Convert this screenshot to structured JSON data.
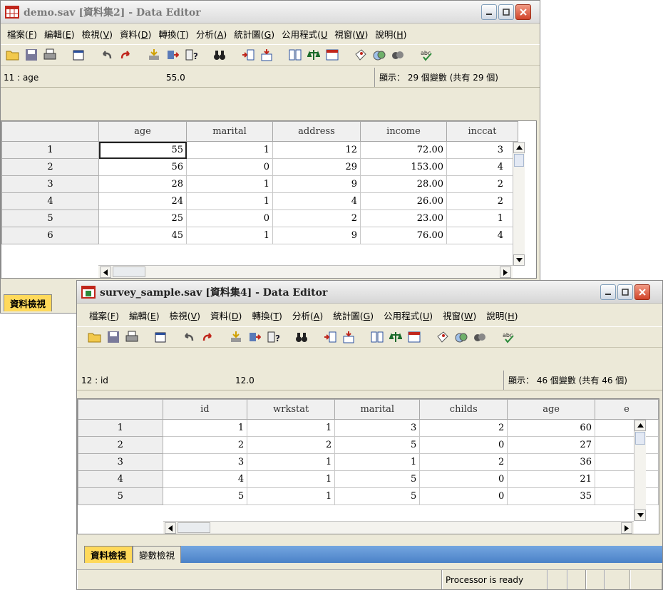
{
  "window1": {
    "title": "demo.sav [資料集2] - Data Editor",
    "menu": [
      {
        "label": "檔案(",
        "key": "F",
        "end": ")"
      },
      {
        "label": "編輯(",
        "key": "E",
        "end": ")"
      },
      {
        "label": "檢視(",
        "key": "V",
        "end": ")"
      },
      {
        "label": "資料(",
        "key": "D",
        "end": ")"
      },
      {
        "label": "轉換(",
        "key": "T",
        "end": ")"
      },
      {
        "label": "分析(",
        "key": "A",
        "end": ")"
      },
      {
        "label": "統計圖(",
        "key": "G",
        "end": ")"
      },
      {
        "label": "公用程式(",
        "key": "U",
        "end": ""
      },
      {
        "label": "視窗(",
        "key": "W",
        "end": ")"
      },
      {
        "label": "說明(",
        "key": "H",
        "end": ")"
      }
    ],
    "cell_ref": "11 : age",
    "cell_value": "55.0",
    "var_info": "顯示： 29 個變數 (共有 29 個)",
    "columns": [
      "age",
      "marital",
      "address",
      "income",
      "inccat"
    ],
    "rows": [
      [
        "1",
        "55",
        "1",
        "12",
        "72.00",
        "3"
      ],
      [
        "2",
        "56",
        "0",
        "29",
        "153.00",
        "4"
      ],
      [
        "3",
        "28",
        "1",
        "9",
        "28.00",
        "2"
      ],
      [
        "4",
        "24",
        "1",
        "4",
        "26.00",
        "2"
      ],
      [
        "5",
        "25",
        "0",
        "2",
        "23.00",
        "1"
      ],
      [
        "6",
        "45",
        "1",
        "9",
        "76.00",
        "4"
      ]
    ],
    "tab_data_view": "資料檢視"
  },
  "window2": {
    "title": "survey_sample.sav [資料集4] - Data Editor",
    "menu": [
      {
        "label": "檔案(",
        "key": "F",
        "end": ")"
      },
      {
        "label": "編輯(",
        "key": "E",
        "end": ")"
      },
      {
        "label": "檢視(",
        "key": "V",
        "end": ")"
      },
      {
        "label": "資料(",
        "key": "D",
        "end": ")"
      },
      {
        "label": "轉換(",
        "key": "T",
        "end": ")"
      },
      {
        "label": "分析(",
        "key": "A",
        "end": ")"
      },
      {
        "label": "統計圖(",
        "key": "G",
        "end": ")"
      },
      {
        "label": "公用程式(",
        "key": "U",
        "end": ")"
      },
      {
        "label": "視窗(",
        "key": "W",
        "end": ")"
      },
      {
        "label": "說明(",
        "key": "H",
        "end": ")"
      }
    ],
    "cell_ref": "12 : id",
    "cell_value": "12.0",
    "var_info": "顯示： 46 個變數 (共有 46 個)",
    "columns": [
      "id",
      "wrkstat",
      "marital",
      "childs",
      "age",
      "e"
    ],
    "rows": [
      [
        "1",
        "1",
        "1",
        "3",
        "2",
        "60"
      ],
      [
        "2",
        "2",
        "2",
        "5",
        "0",
        "27"
      ],
      [
        "3",
        "3",
        "1",
        "1",
        "2",
        "36"
      ],
      [
        "4",
        "4",
        "1",
        "5",
        "0",
        "21"
      ],
      [
        "5",
        "5",
        "1",
        "5",
        "0",
        "35"
      ]
    ],
    "tab_data_view": "資料檢視",
    "tab_variable_view": "變數檢視",
    "status": "Processor is ready"
  },
  "colors": {
    "active_tab": "#ffd95a",
    "tab_bar": "#4b82c8",
    "close_button": "#d1442a"
  }
}
